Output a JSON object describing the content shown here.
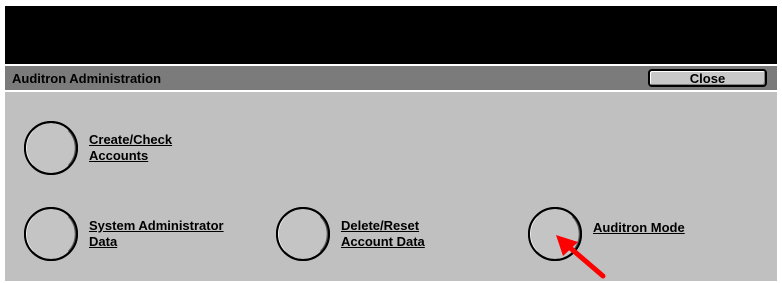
{
  "window": {
    "title": "Auditron Administration",
    "close_label": "Close"
  },
  "features": [
    {
      "line1": "Create/Check",
      "line2": "Accounts"
    },
    {
      "line1": "System Administrator",
      "line2": "Data"
    },
    {
      "line1": "Delete/Reset",
      "line2": "Account Data"
    },
    {
      "line1": "Auditron Mode",
      "line2": ""
    }
  ],
  "colors": {
    "panel": "#c0c0c0",
    "title_bar": "#7b7b7b",
    "message_area": "#000000",
    "pointer_arrow": "#ff0000"
  },
  "annotation": {
    "icon": "red-pointer-arrow",
    "target": "Auditron Mode"
  }
}
